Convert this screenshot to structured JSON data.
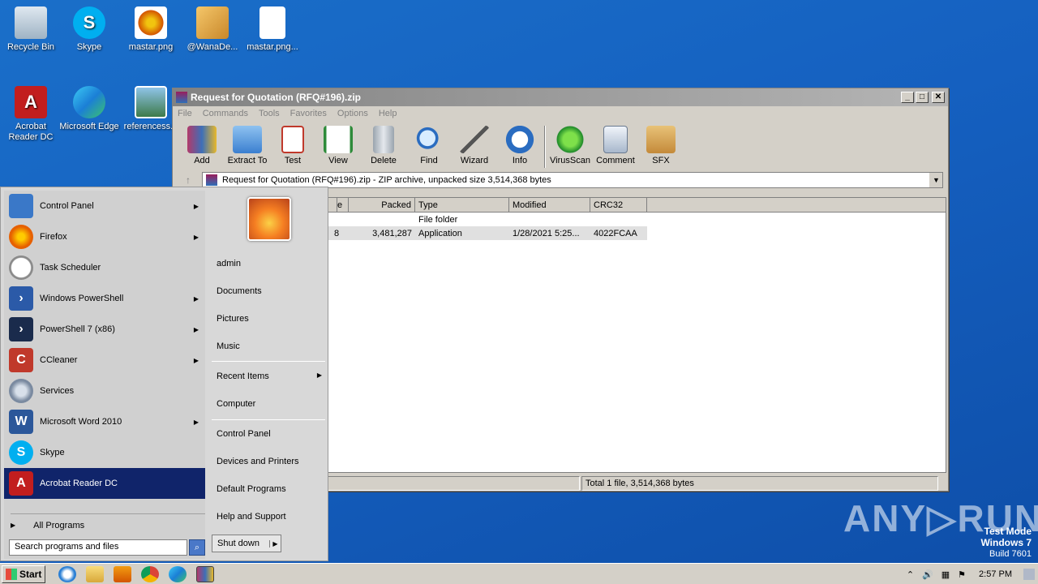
{
  "desktop": {
    "icons": [
      {
        "label": "Recycle Bin",
        "icon": "recycle-bin-icon"
      },
      {
        "label": "Skype",
        "icon": "skype-icon"
      },
      {
        "label": "mastar.png",
        "icon": "image-file-icon"
      },
      {
        "label": "@WanaDe...",
        "icon": "handshake-icon"
      },
      {
        "label": "mastar.png...",
        "icon": "blank-file-icon"
      },
      {
        "label": "Acrobat Reader DC",
        "icon": "acrobat-icon"
      },
      {
        "label": "Microsoft Edge",
        "icon": "edge-icon"
      },
      {
        "label": "referencess...",
        "icon": "image-file-icon"
      }
    ]
  },
  "winrar": {
    "title": "Request for Quotation (RFQ#196).zip",
    "menu": [
      "File",
      "Commands",
      "Tools",
      "Favorites",
      "Options",
      "Help"
    ],
    "toolbar": [
      "Add",
      "Extract To",
      "Test",
      "View",
      "Delete",
      "Find",
      "Wizard",
      "Info",
      "VirusScan",
      "Comment",
      "SFX"
    ],
    "path": "Request for Quotation (RFQ#196).zip - ZIP archive, unpacked size 3,514,368 bytes",
    "columns": [
      "e",
      "Packed",
      "Type",
      "Modified",
      "CRC32"
    ],
    "rows": [
      {
        "size": "",
        "packed": "",
        "type": "File folder",
        "modified": "",
        "crc": ""
      },
      {
        "size": "8",
        "packed": "3,481,287",
        "type": "Application",
        "modified": "1/28/2021 5:25...",
        "crc": "4022FCAA"
      }
    ],
    "status_left": "es",
    "status_right": "Total 1 file, 3,514,368 bytes"
  },
  "startmenu": {
    "left_items": [
      {
        "label": "Control Panel",
        "arrow": true,
        "color": "#3a78c8"
      },
      {
        "label": "Firefox",
        "arrow": true,
        "color": "#e66000"
      },
      {
        "label": "Task Scheduler",
        "arrow": false,
        "color": "#8a8a8a"
      },
      {
        "label": "Windows PowerShell",
        "arrow": true,
        "color": "#2b5aa8"
      },
      {
        "label": "PowerShell 7 (x86)",
        "arrow": true,
        "color": "#1a2b4c"
      },
      {
        "label": "CCleaner",
        "arrow": true,
        "color": "#c0392b"
      },
      {
        "label": "Services",
        "arrow": false,
        "color": "#7a8aa0"
      },
      {
        "label": "Microsoft Word 2010",
        "arrow": true,
        "color": "#2b579a"
      },
      {
        "label": "Skype",
        "arrow": false,
        "color": "#00aff0"
      },
      {
        "label": "Acrobat Reader DC",
        "arrow": false,
        "color": "#c21e1e"
      }
    ],
    "all_programs": "All Programs",
    "search_placeholder": "Search programs and files",
    "right_items": [
      "admin",
      "Documents",
      "Pictures",
      "Music",
      "Recent Items",
      "Computer",
      "Control Panel",
      "Devices and Printers",
      "Default Programs",
      "Help and Support"
    ],
    "shutdown": "Shut down"
  },
  "taskbar": {
    "start": "Start",
    "time": "2:57 PM"
  },
  "watermark": {
    "line1": "Test Mode",
    "line2": "Windows 7",
    "line3": "Build 7601",
    "brand": "ANY▷RUN"
  }
}
